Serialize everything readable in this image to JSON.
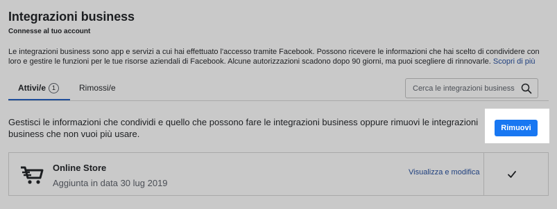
{
  "header": {
    "title": "Integrazioni business",
    "subtitle": "Connesse al tuo account"
  },
  "description": {
    "text": "Le integrazioni business sono app e servizi a cui hai effettuato l'accesso tramite Facebook. Possono ricevere le informazioni che hai scelto di condividere con loro e gestire le funzioni per le tue risorse aziendali di Facebook. Alcune autorizzazioni scadono dopo 90 giorni, ma puoi scegliere di rinnovarle.",
    "link": "Scopri di più"
  },
  "tabs": [
    {
      "label": "Attivi/e",
      "count": "1",
      "active": true
    },
    {
      "label": "Rimossi/e",
      "active": false
    }
  ],
  "search": {
    "placeholder": "Cerca le integrazioni business",
    "icon": "search-icon"
  },
  "manage": {
    "text": "Gestisci le informazioni che condividi e quello che possono fare le integrazioni business oppure rimuovi le integrazioni business che non vuoi più usare.",
    "remove_label": "Rimuovi"
  },
  "integrations": [
    {
      "icon": "shopping-cart-icon",
      "name": "Online Store",
      "added": "Aggiunta in data 30 lug 2019",
      "action": "Visualizza e modifica",
      "checked": true
    }
  ],
  "colors": {
    "overlay_bg": "#c9c9c9",
    "primary_button": "#1877f2",
    "link": "#1e3f7e",
    "tab_indicator": "#1f4e9a"
  }
}
